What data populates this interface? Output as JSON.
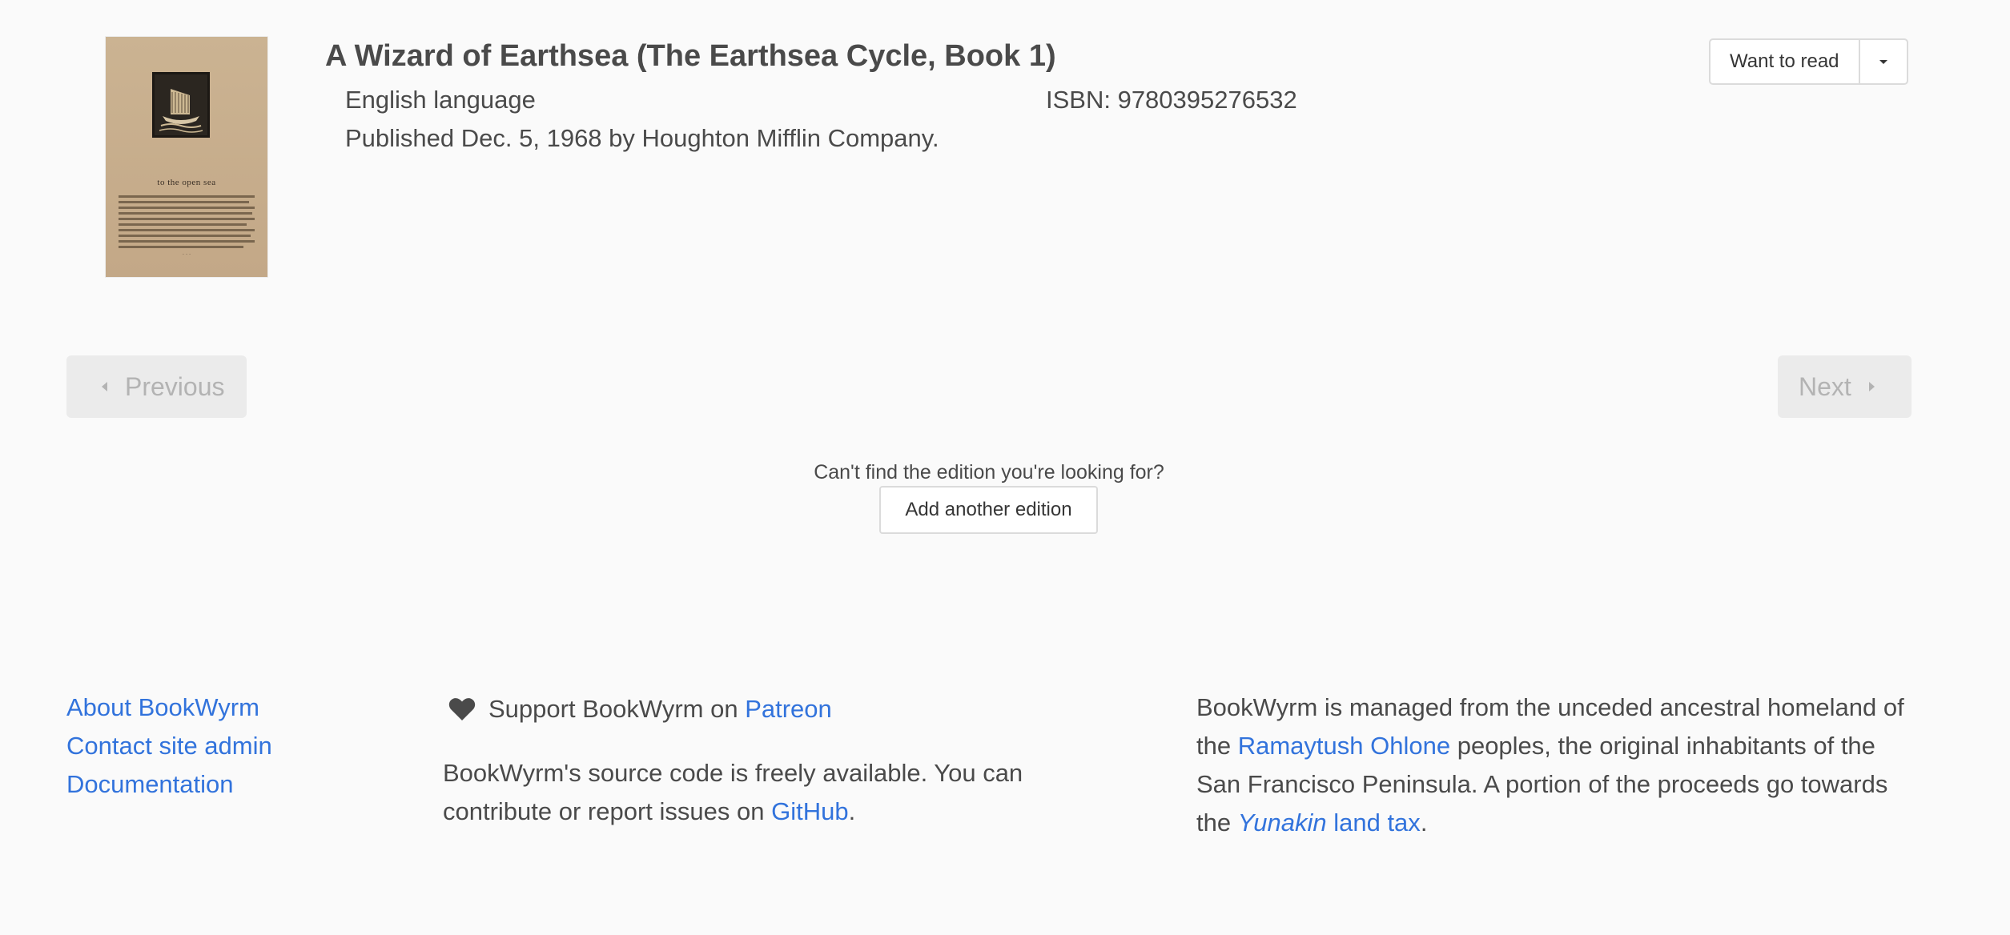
{
  "edition": {
    "title": "A Wizard of Earthsea (The Earthsea Cycle, Book 1)",
    "language": "English language",
    "isbn": "ISBN: 9780395276532",
    "published": "Published Dec. 5, 1968 by Houghton Mifflin Company.",
    "cover": {
      "title_text": "to the open sea"
    }
  },
  "shelve": {
    "button_label": "Want to read",
    "dropdown_icon": "caret-down-icon"
  },
  "pagination": {
    "previous_label": "Previous",
    "next_label": "Next"
  },
  "add_edition": {
    "prompt": "Can't find the edition you're looking for?",
    "button_label": "Add another edition"
  },
  "footer": {
    "links": {
      "about": "About BookWyrm",
      "contact": "Contact site admin",
      "docs": "Documentation"
    },
    "support": {
      "icon": "heart-icon",
      "prefix": "Support BookWyrm on ",
      "link": "Patreon"
    },
    "source": {
      "prefix": "BookWyrm's source code is freely available. You can contribute or report issues on ",
      "link": "GitHub",
      "suffix": "."
    },
    "land": {
      "part1": "BookWyrm is managed from the unceded ancestral homeland of the ",
      "link1": "Ramaytush Ohlone",
      "part2": " peoples, the original inhabitants of the San Francisco Peninsula. A portion of the proceeds go towards the ",
      "link2_italic": "Yunakin",
      "link2_rest": " land tax",
      "suffix": "."
    }
  },
  "colors": {
    "link": "#3273dc",
    "text": "#4a4a4a",
    "disabled_bg": "#ebebeb",
    "disabled_text": "#b3b3b3",
    "background": "#fafafa"
  }
}
